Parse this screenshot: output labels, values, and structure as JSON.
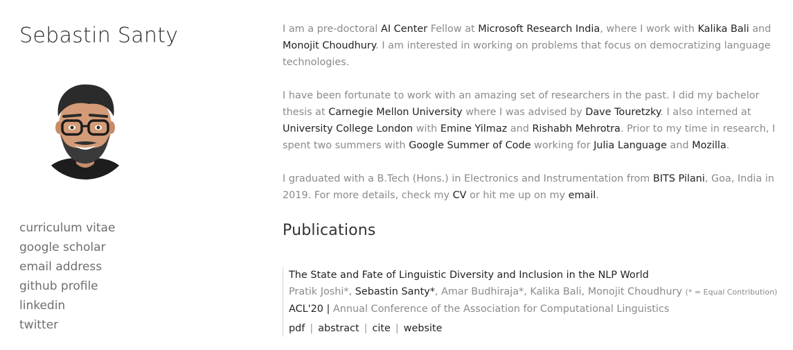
{
  "profile": {
    "name": "Sebastin Santy"
  },
  "links": [
    "curriculum vitae",
    "google scholar",
    "email address",
    "github profile",
    "linkedin",
    "twitter"
  ],
  "bio": {
    "p1": {
      "t0": "I am a pre-doctoral ",
      "l0": "AI Center",
      "t1": " Fellow at ",
      "l1": "Microsoft Research India",
      "t2": ", where I work with ",
      "l2": "Kalika Bali",
      "t3": " and ",
      "l3": "Monojit Choudhury",
      "t4": ". I am interested in working on problems that focus on democratizing language technologies."
    },
    "p2": {
      "t0": "I have been fortunate to work with an amazing set of researchers in the past. I did my bachelor thesis at ",
      "l0": "Carnegie Mellon University",
      "t1": " where I was advised by ",
      "l1": "Dave Touretzky",
      "t2": ". I also interned at ",
      "l2": "University College London",
      "t3": " with ",
      "l3": "Emine Yilmaz",
      "t4": " and ",
      "l4": "Rishabh Mehrotra",
      "t5": ". Prior to my time in research, I spent two summers with ",
      "l5": "Google Summer of Code",
      "t6": " working for ",
      "l6": "Julia Language",
      "t7": " and ",
      "l7": "Mozilla",
      "t8": "."
    },
    "p3": {
      "t0": "I graduated with a B.Tech (Hons.) in Electronics and Instrumentation from ",
      "l0": "BITS Pilani",
      "t1": ", Goa, India in 2019. For more details, check my ",
      "l1": "CV",
      "t2": " or hit me up on my ",
      "l2": "email",
      "t3": "."
    }
  },
  "publications": {
    "heading": "Publications",
    "items": [
      {
        "title": "The State and Fate of Linguistic Diversity and Inclusion in the NLP World",
        "author1": "Pratik Joshi*, ",
        "author_me": "Sebastin Santy*",
        "author_rest": ", Amar Budhiraja*, Kalika Bali, Monojit Choudhury",
        "note": "(* = Equal Contribution)",
        "venue_short": "ACL'20 |",
        "venue_long": " Annual Conference of the Association for Computational Linguistics",
        "links": [
          "pdf",
          "abstract",
          "cite",
          "website"
        ],
        "separator": "|"
      }
    ]
  },
  "colors": {
    "text": "#8a8a8a",
    "link": "#222222"
  },
  "icons": {
    "avatar": "cartoon-portrait"
  }
}
